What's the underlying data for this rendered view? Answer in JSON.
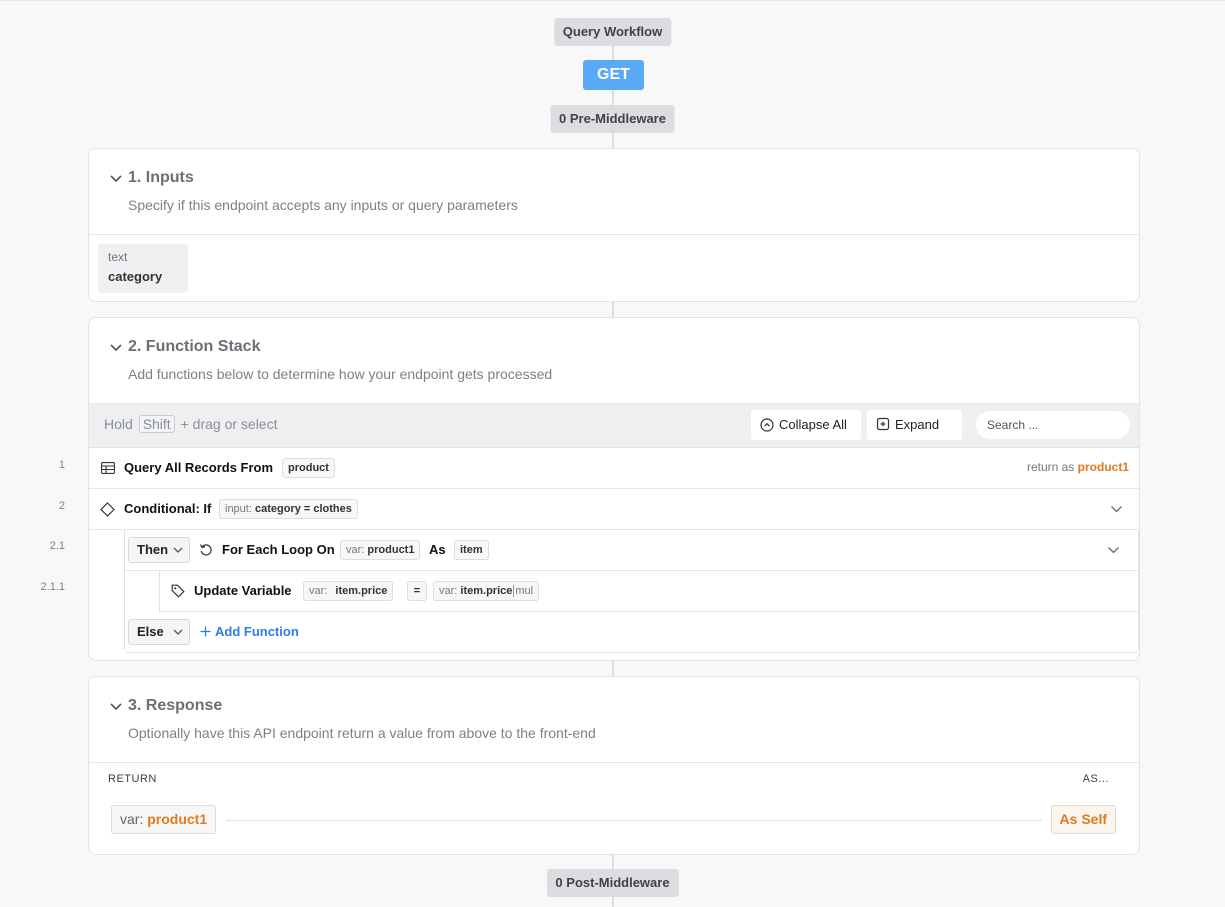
{
  "workflow": {
    "title": "Query Workflow",
    "method": "GET",
    "pre_middleware": "0 Pre-Middleware",
    "post_middleware": "0 Post-Middleware"
  },
  "inputs": {
    "title": "1. Inputs",
    "subtitle": "Specify if this endpoint accepts any inputs or query parameters",
    "items": [
      {
        "type": "text",
        "name": "category"
      }
    ]
  },
  "function_stack": {
    "title": "2. Function Stack",
    "subtitle": "Add functions below to determine how your endpoint gets processed",
    "toolbar": {
      "hold": "Hold",
      "shift_key": "Shift",
      "drag_hint": "+ drag or select",
      "collapse_all": "Collapse All",
      "expand": "Expand",
      "search_placeholder": "Search ..."
    },
    "rows": [
      {
        "num": "1",
        "label": "Query All Records From",
        "table": "product",
        "return_as_label": "return as",
        "return_as": "product1"
      },
      {
        "num": "2",
        "label": "Conditional: If",
        "cond_prefix": "input:",
        "cond_value": "category = clothes"
      },
      {
        "num": "2.1",
        "branch": "Then",
        "label": "For Each Loop On",
        "var_prefix": "var:",
        "var_value": "product1",
        "as_label": "As",
        "as_value": "item"
      },
      {
        "num": "2.1.1",
        "label": "Update Variable",
        "var_prefix": "var:",
        "var_value": "item.price",
        "eq": "=",
        "val_prefix": "var:",
        "val_value": "item.price",
        "val_filter": "mul"
      },
      {
        "branch": "Else",
        "add_function": "Add Function"
      }
    ]
  },
  "response": {
    "title": "3. Response",
    "subtitle": "Optionally have this API endpoint return a value from above to the front-end",
    "return_header": "RETURN",
    "as_header": "AS...",
    "var_prefix": "var:",
    "var_value": "product1",
    "as_value": "As Self"
  }
}
